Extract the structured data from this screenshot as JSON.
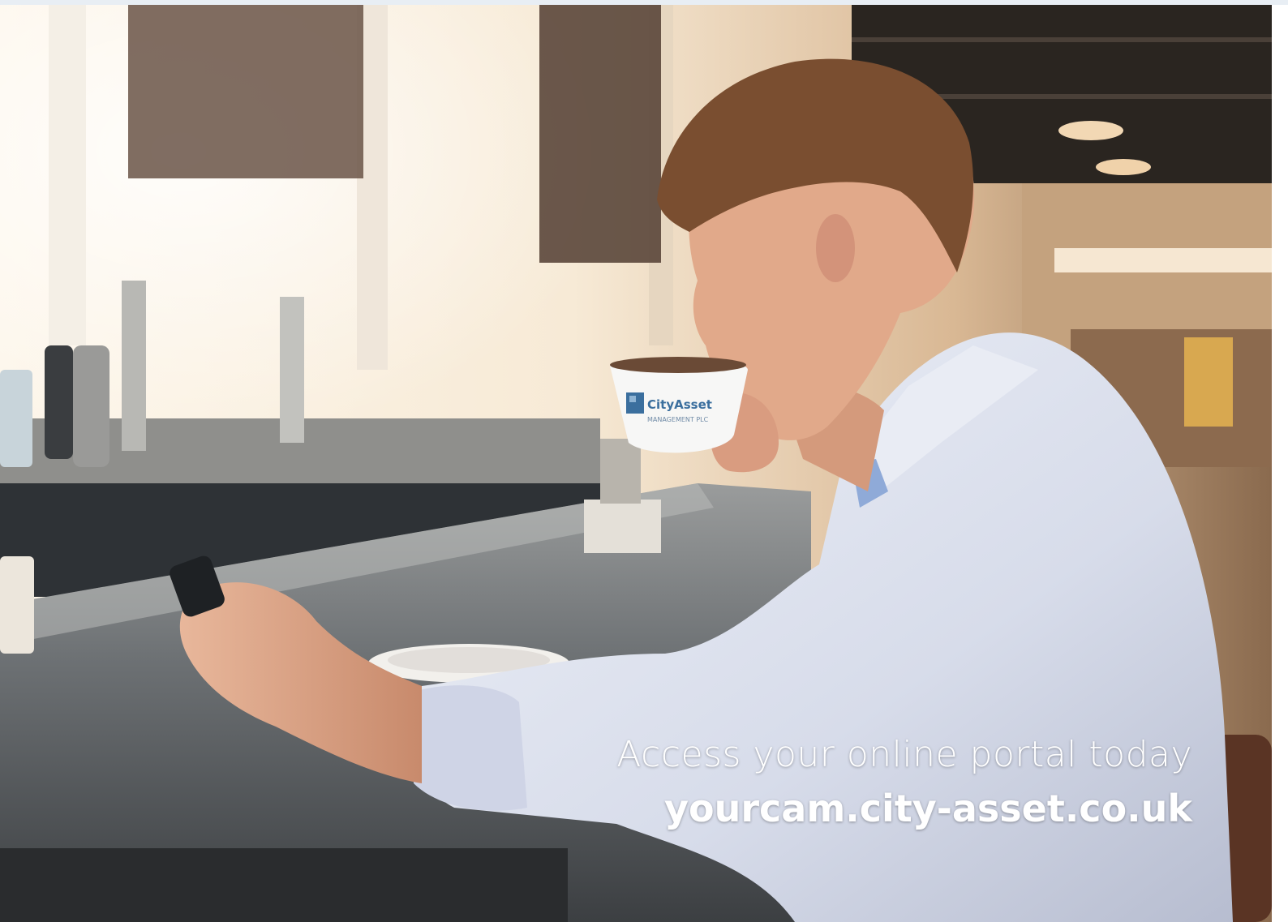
{
  "ad": {
    "headline": "Access your online portal today",
    "url": "yourcam.city-asset.co.uk"
  },
  "cup_logo": {
    "brand": "CityAsset",
    "subtitle": "MANAGEMENT PLC"
  },
  "colors": {
    "text": "#ffffff",
    "logo_blue": "#3b6f9e",
    "shirt": "#dfe4f0",
    "counter": "#5f6468"
  }
}
